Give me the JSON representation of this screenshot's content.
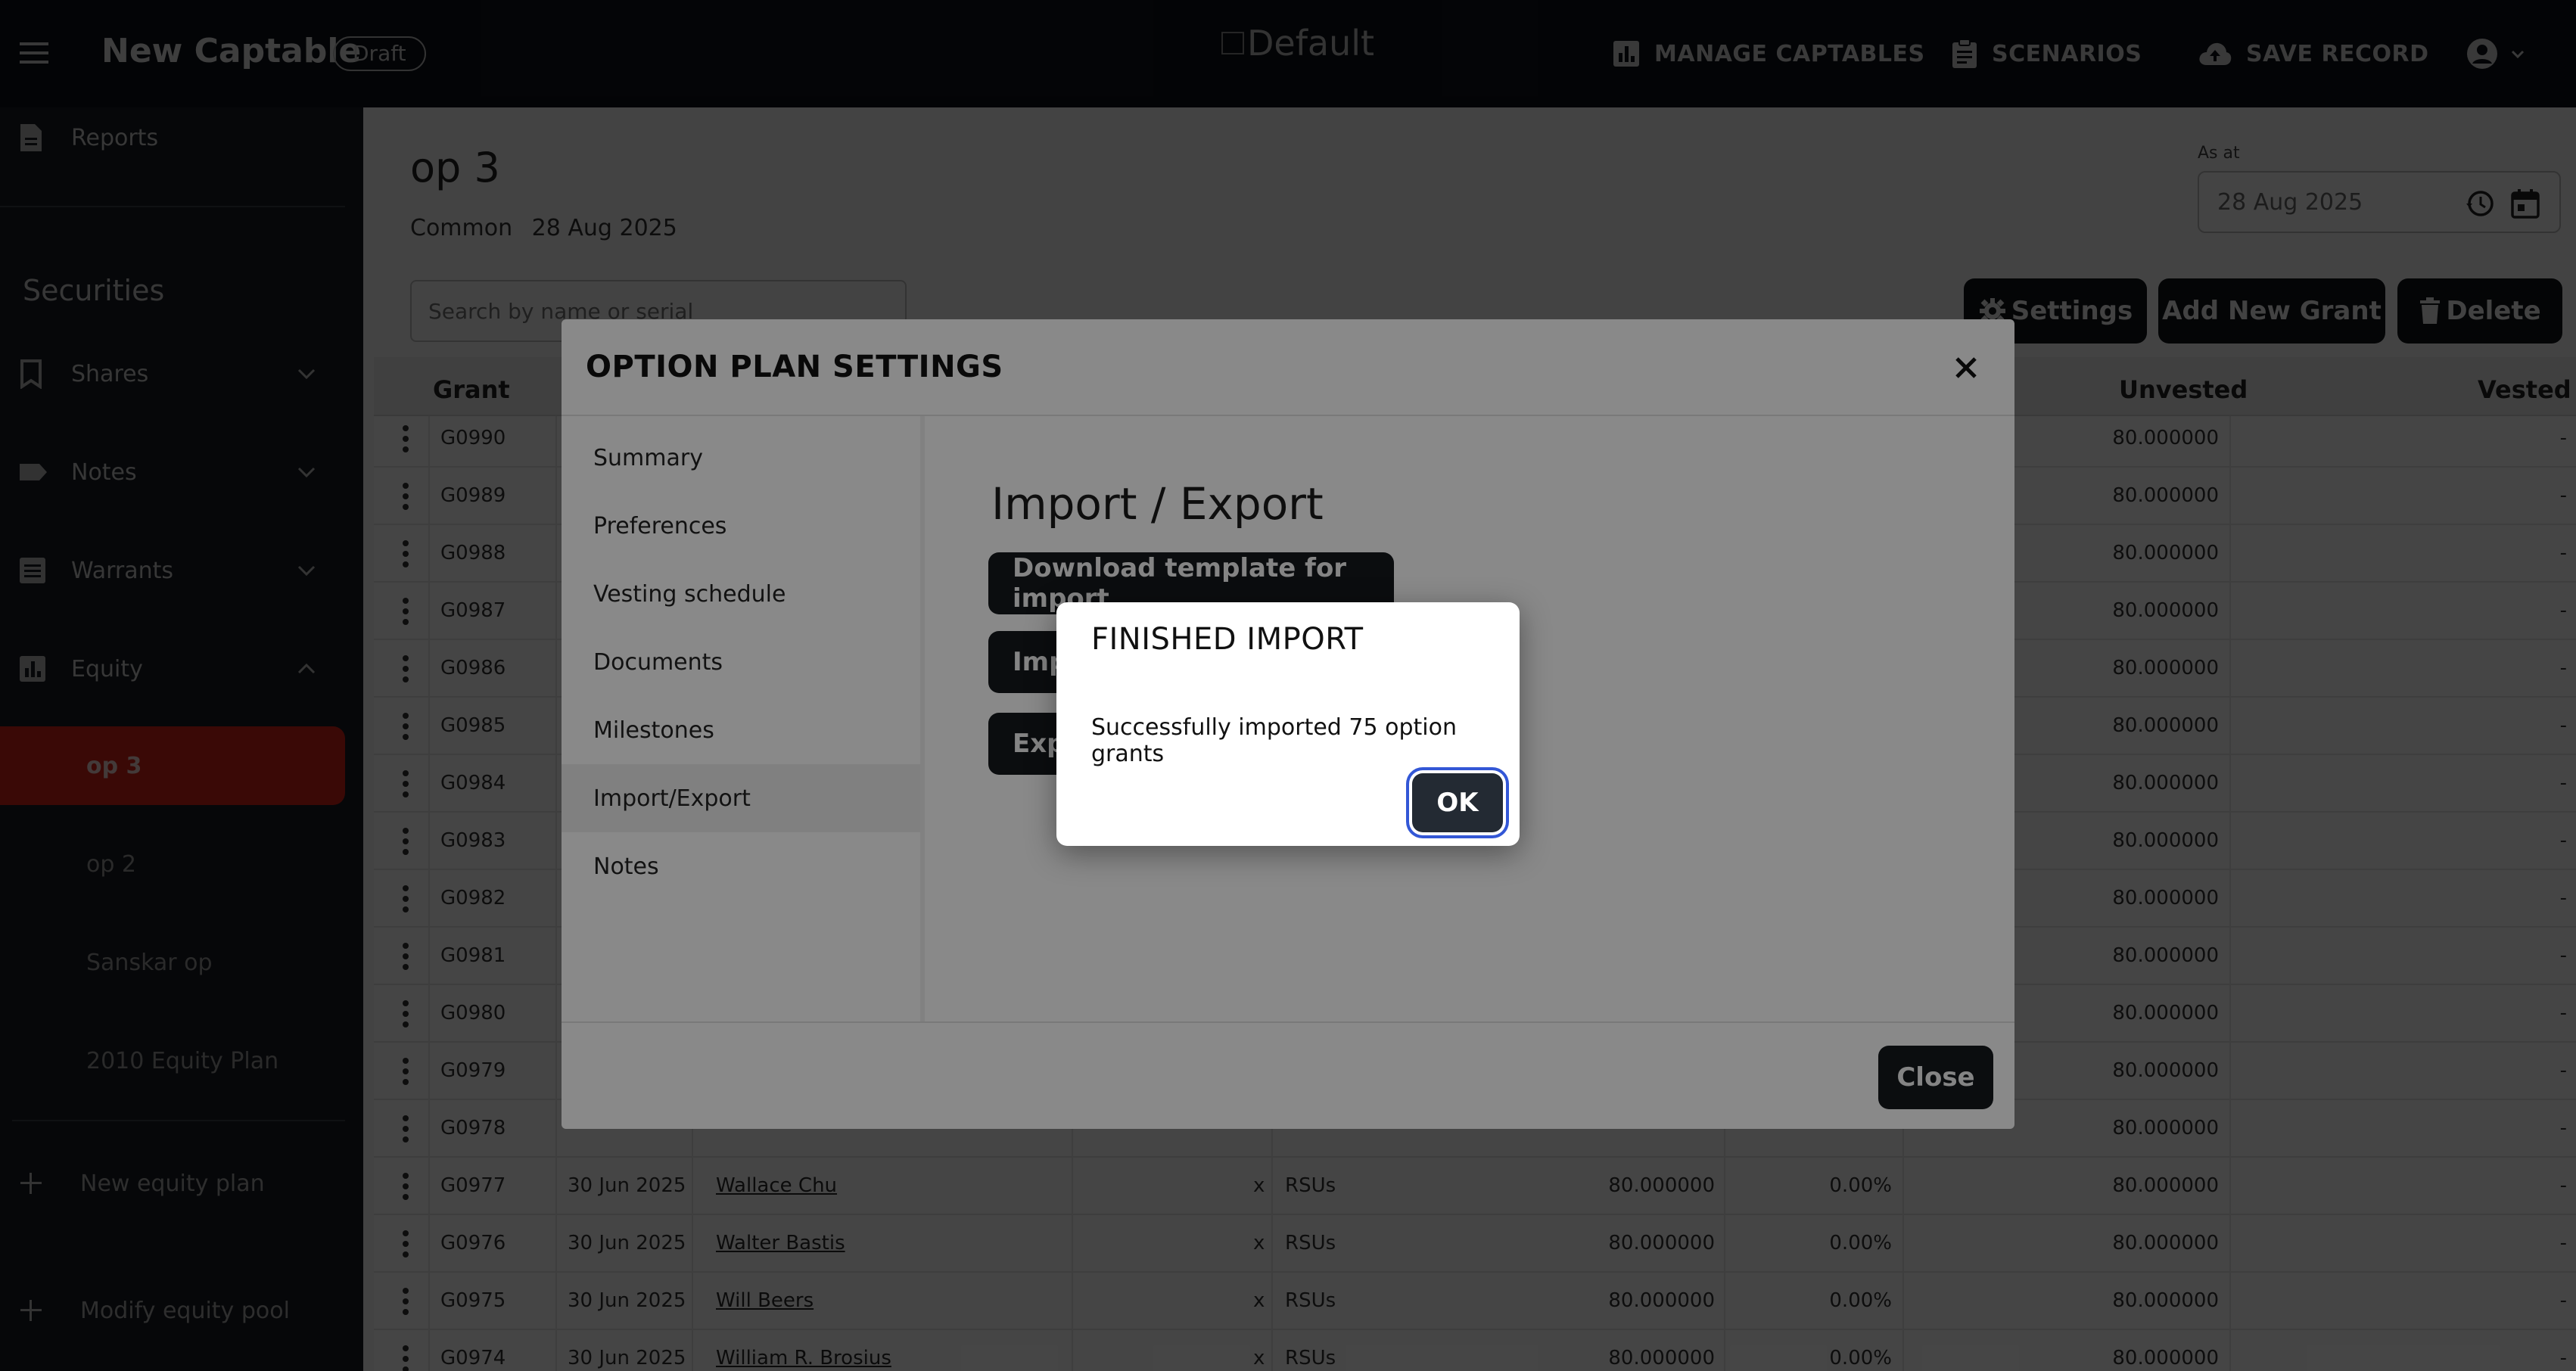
{
  "topbar": {
    "app_title": "New Captable",
    "status_badge": "Draft",
    "logo_alt": "Default",
    "nav": {
      "manage_captables": "MANAGE CAPTABLES",
      "scenarios": "SCENARIOS",
      "save_record": "SAVE RECORD"
    },
    "icons": [
      "menu-icon",
      "bar-chart-icon",
      "clipboard-icon",
      "cloud-upload-icon",
      "account-circle-icon",
      "caret-down-icon"
    ]
  },
  "sidebar": {
    "reports_label": "Reports",
    "section_heading": "Securities",
    "groups": [
      {
        "label": "Shares",
        "icon": "bookmark-icon",
        "expanded": false
      },
      {
        "label": "Notes",
        "icon": "tag-icon",
        "expanded": false
      },
      {
        "label": "Warrants",
        "icon": "list-box-icon",
        "expanded": false
      },
      {
        "label": "Equity",
        "icon": "bar-chart-icon",
        "expanded": true
      }
    ],
    "equity_plans": [
      "op 3",
      "op 2",
      "Sanskar op",
      "2010 Equity Plan"
    ],
    "active_plan": "op 3",
    "actions": [
      "New equity plan",
      "Modify equity pool"
    ]
  },
  "page": {
    "title": "op 3",
    "share_class": "Common",
    "date": "28 Aug 2025",
    "search_placeholder": "Search by name or serial",
    "as_at_label": "As at",
    "as_at_value": "28 Aug 2025",
    "buttons": {
      "settings": "Settings",
      "add_grant": "Add New Grant",
      "delete": "Delete"
    }
  },
  "table": {
    "headers": {
      "grant": "Grant",
      "unvested": "Unvested",
      "vested": "Vested"
    },
    "rows": [
      {
        "id": "G0990",
        "date": "",
        "name": "",
        "x": "",
        "type": "",
        "qty": "",
        "pct": "",
        "unvested": "80.000000",
        "vested": "-"
      },
      {
        "id": "G0989",
        "date": "",
        "name": "",
        "x": "",
        "type": "",
        "qty": "",
        "pct": "",
        "unvested": "80.000000",
        "vested": "-"
      },
      {
        "id": "G0988",
        "date": "",
        "name": "",
        "x": "",
        "type": "",
        "qty": "",
        "pct": "",
        "unvested": "80.000000",
        "vested": "-"
      },
      {
        "id": "G0987",
        "date": "",
        "name": "",
        "x": "",
        "type": "",
        "qty": "",
        "pct": "",
        "unvested": "80.000000",
        "vested": "-"
      },
      {
        "id": "G0986",
        "date": "",
        "name": "",
        "x": "",
        "type": "",
        "qty": "",
        "pct": "",
        "unvested": "80.000000",
        "vested": "-"
      },
      {
        "id": "G0985",
        "date": "",
        "name": "",
        "x": "",
        "type": "",
        "qty": "",
        "pct": "",
        "unvested": "80.000000",
        "vested": "-"
      },
      {
        "id": "G0984",
        "date": "",
        "name": "",
        "x": "",
        "type": "",
        "qty": "",
        "pct": "",
        "unvested": "80.000000",
        "vested": "-"
      },
      {
        "id": "G0983",
        "date": "",
        "name": "",
        "x": "",
        "type": "",
        "qty": "",
        "pct": "",
        "unvested": "80.000000",
        "vested": "-"
      },
      {
        "id": "G0982",
        "date": "",
        "name": "",
        "x": "",
        "type": "",
        "qty": "",
        "pct": "",
        "unvested": "80.000000",
        "vested": "-"
      },
      {
        "id": "G0981",
        "date": "",
        "name": "",
        "x": "",
        "type": "",
        "qty": "",
        "pct": "",
        "unvested": "80.000000",
        "vested": "-"
      },
      {
        "id": "G0980",
        "date": "",
        "name": "",
        "x": "",
        "type": "",
        "qty": "",
        "pct": "",
        "unvested": "80.000000",
        "vested": "-"
      },
      {
        "id": "G0979",
        "date": "",
        "name": "",
        "x": "",
        "type": "",
        "qty": "",
        "pct": "",
        "unvested": "80.000000",
        "vested": "-"
      },
      {
        "id": "G0978",
        "date": "",
        "name": "",
        "x": "",
        "type": "",
        "qty": "",
        "pct": "",
        "unvested": "80.000000",
        "vested": "-"
      },
      {
        "id": "G0977",
        "date": "30 Jun 2025",
        "name": "Wallace Chu",
        "x": "x",
        "type": "RSUs",
        "qty": "80.000000",
        "pct": "0.00%",
        "unvested": "80.000000",
        "vested": "-"
      },
      {
        "id": "G0976",
        "date": "30 Jun 2025",
        "name": "Walter Bastis",
        "x": "x",
        "type": "RSUs",
        "qty": "80.000000",
        "pct": "0.00%",
        "unvested": "80.000000",
        "vested": "-"
      },
      {
        "id": "G0975",
        "date": "30 Jun 2025",
        "name": "Will Beers",
        "x": "x",
        "type": "RSUs",
        "qty": "80.000000",
        "pct": "0.00%",
        "unvested": "80.000000",
        "vested": "-"
      },
      {
        "id": "G0974",
        "date": "30 Jun 2025",
        "name": "William R. Brosius",
        "x": "x",
        "type": "RSUs",
        "qty": "80.000000",
        "pct": "0.00%",
        "unvested": "80.000000",
        "vested": "-"
      }
    ]
  },
  "modal": {
    "title": "OPTION PLAN SETTINGS",
    "nav": [
      "Summary",
      "Preferences",
      "Vesting schedule",
      "Documents",
      "Milestones",
      "Import/Export",
      "Notes"
    ],
    "active_nav": "Import/Export",
    "heading": "Import / Export",
    "download_btn": "Download template for import",
    "import_btn": "Imp",
    "export_btn": "Exp",
    "close_btn": "Close"
  },
  "dialog": {
    "title": "FINISHED IMPORT",
    "message": "Successfully imported 75 option grants",
    "ok": "OK"
  },
  "colors": {
    "topbar_bg": "#0f1318",
    "sidebar_bg": "#161b22",
    "active_item": "#d62418",
    "button_dark": "#14181d",
    "focus_ring": "#3357d6"
  }
}
